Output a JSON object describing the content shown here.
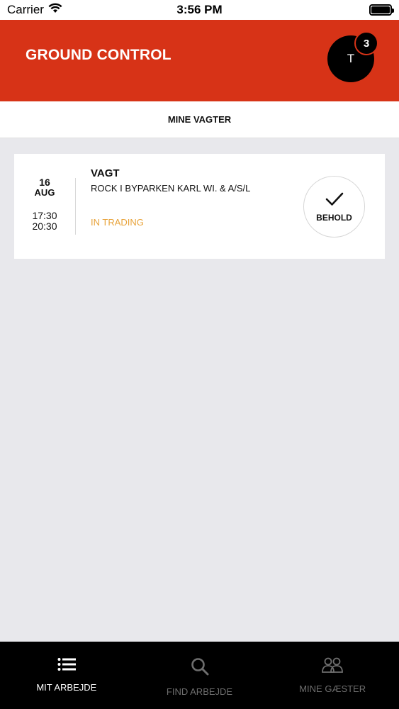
{
  "status_bar": {
    "carrier": "Carrier",
    "time": "3:56 PM"
  },
  "header": {
    "title": "GROUND CONTROL",
    "avatar_initial": "T",
    "notification_count": "3",
    "accent_color": "#d73317"
  },
  "section": {
    "title": "MINE VAGTER"
  },
  "shifts": [
    {
      "day": "16",
      "month": "AUG",
      "start_time": "17:30",
      "end_time": "20:30",
      "title": "VAGT",
      "venue": "ROCK I BYPARKEN KARL WI. & A/S/L",
      "status": "IN TRADING",
      "status_color": "#e8a33a",
      "action_label": "BEHOLD",
      "action_icon": "checkmark-icon"
    }
  ],
  "tab_bar": {
    "tabs": [
      {
        "label": "MIT ARBEJDE",
        "icon": "list-icon",
        "active": true
      },
      {
        "label": "FIND ARBEJDE",
        "icon": "search-icon",
        "active": false
      },
      {
        "label": "MINE GÆSTER",
        "icon": "people-icon",
        "active": false
      }
    ]
  }
}
